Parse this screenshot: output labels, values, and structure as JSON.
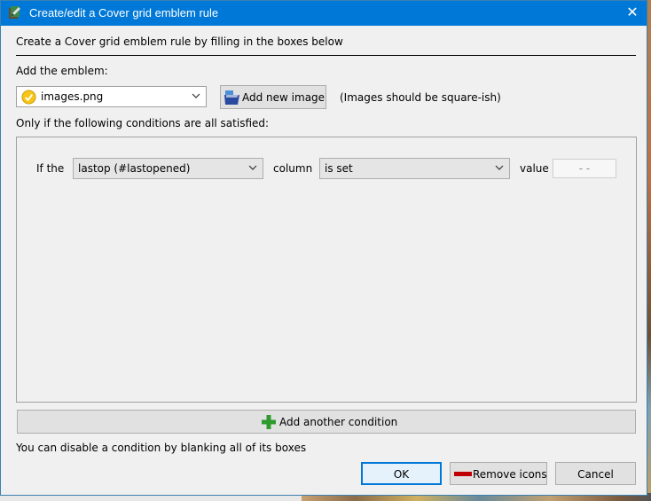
{
  "window": {
    "title": "Create/edit a Cover grid emblem rule",
    "close_glyph": "✕"
  },
  "header": {
    "instructions": "Create a Cover grid emblem rule by filling in the boxes below"
  },
  "emblem": {
    "label": "Add the emblem:",
    "selected_image": "images.png",
    "add_new_image_label": "Add new image",
    "hint": "(Images should be square-ish)"
  },
  "conditions": {
    "label": "Only if the following conditions are all satisfied:",
    "rows": [
      {
        "prefix": "If the",
        "field": "lastop (#lastopened)",
        "column_label": "column",
        "operator": "is set",
        "value_label": "value",
        "value": "- -"
      }
    ],
    "add_label": "Add another condition",
    "disable_hint": "You can disable a condition by blanking all of its boxes"
  },
  "buttons": {
    "ok": "OK",
    "remove_icons": "Remove icons",
    "cancel": "Cancel"
  },
  "colors": {
    "titlebar": "#0078d7",
    "dialog_bg": "#f0f0f0",
    "accent_green": "#2e9b2e",
    "remove_red": "#c00000"
  }
}
